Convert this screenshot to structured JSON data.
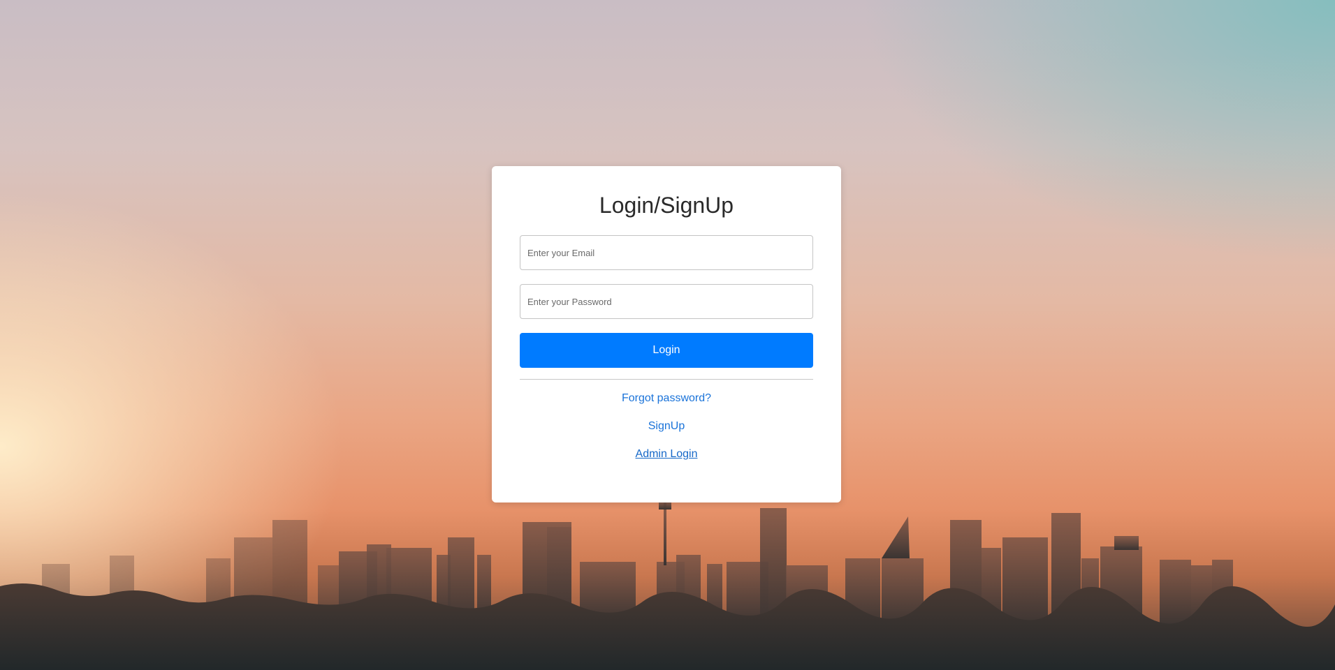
{
  "login_card": {
    "title": "Login/SignUp",
    "email_placeholder": "Enter your Email",
    "password_placeholder": "Enter your Password",
    "login_button_label": "Login",
    "forgot_password_label": "Forgot password?",
    "signup_label": "SignUp",
    "admin_login_label": "Admin Login"
  },
  "colors": {
    "primary": "#007bff",
    "link": "#1a73d9",
    "card_background": "#ffffff"
  }
}
